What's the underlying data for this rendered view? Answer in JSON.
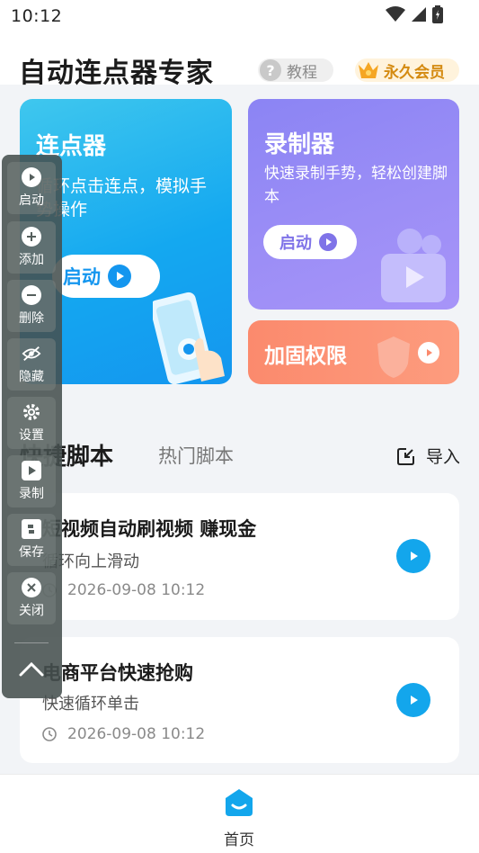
{
  "status_bar": {
    "time": "10:12"
  },
  "header": {
    "app_title": "自动连点器专家",
    "help_label": "教程",
    "vip_label": "永久会员"
  },
  "cards": {
    "clicker": {
      "title": "连点器",
      "desc": "循环点击连点，模拟手势操作",
      "button_label": "启动"
    },
    "recorder": {
      "title": "录制器",
      "desc": "快速录制手势，轻松创建脚本",
      "button_label": "启动"
    },
    "permission": {
      "title": "加固权限"
    }
  },
  "tabs": {
    "quick": "快捷脚本",
    "hot": "热门脚本",
    "import_label": "导入"
  },
  "scripts": [
    {
      "title": "短视频自动刷视频 赚现金",
      "subtitle": "循环向上滑动",
      "time": "2026-09-08 10:12"
    },
    {
      "title": "电商平台快速抢购",
      "subtitle": "快速循环单击",
      "time": "2026-09-08 10:12"
    }
  ],
  "bottom_nav": {
    "home_label": "首页"
  },
  "float_toolbar": {
    "items": [
      {
        "label": "启动",
        "icon": "play-icon"
      },
      {
        "label": "添加",
        "icon": "plus-icon"
      },
      {
        "label": "删除",
        "icon": "minus-icon"
      },
      {
        "label": "隐藏",
        "icon": "eye-off-icon"
      },
      {
        "label": "设置",
        "icon": "gear-icon"
      },
      {
        "label": "录制",
        "icon": "record-icon"
      },
      {
        "label": "保存",
        "icon": "save-icon"
      },
      {
        "label": "关闭",
        "icon": "close-icon"
      }
    ]
  },
  "colors": {
    "clicker_card": "#14a8f0",
    "recorder_card": "#9a8df6",
    "permission_card": "#fb8a6d",
    "accent_blue": "#13a6ec",
    "vip_gold": "#d48a10"
  }
}
